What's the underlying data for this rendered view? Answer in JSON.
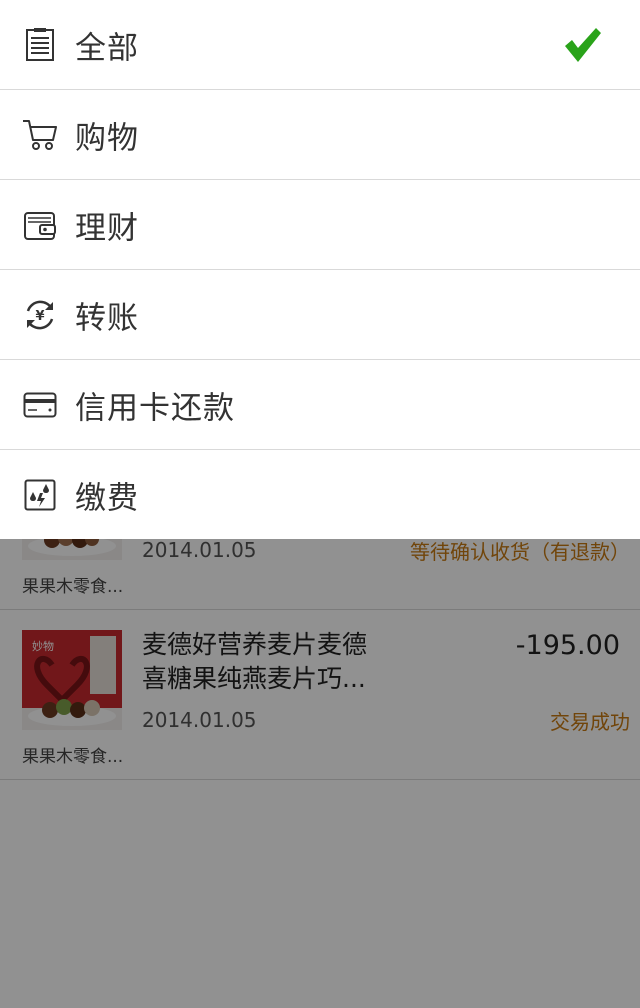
{
  "menu": {
    "items": [
      {
        "label": "全部",
        "icon": "list-icon",
        "selected": true
      },
      {
        "label": "购物",
        "icon": "cart-icon",
        "selected": false
      },
      {
        "label": "理财",
        "icon": "wallet-icon",
        "selected": false
      },
      {
        "label": "转账",
        "icon": "transfer-icon",
        "selected": false
      },
      {
        "label": "信用卡还款",
        "icon": "credit-card-icon",
        "selected": false
      },
      {
        "label": "缴费",
        "icon": "utility-bill-icon",
        "selected": false
      }
    ],
    "check_color": "#2aa31a"
  },
  "transactions": [
    {
      "title": "",
      "amount": "",
      "date": "2014.01.05",
      "status": "等待确认收货（有退款）",
      "shop": "果果木零食..."
    },
    {
      "title": "麦德好营养麦片麦德\n喜糖果纯燕麦片巧...",
      "amount": "-195.00",
      "date": "2014.01.05",
      "status": "交易成功",
      "shop": "果果木零食..."
    }
  ],
  "colors": {
    "status": "#c77a12",
    "overlay": "rgba(0,0,0,0.43)"
  }
}
